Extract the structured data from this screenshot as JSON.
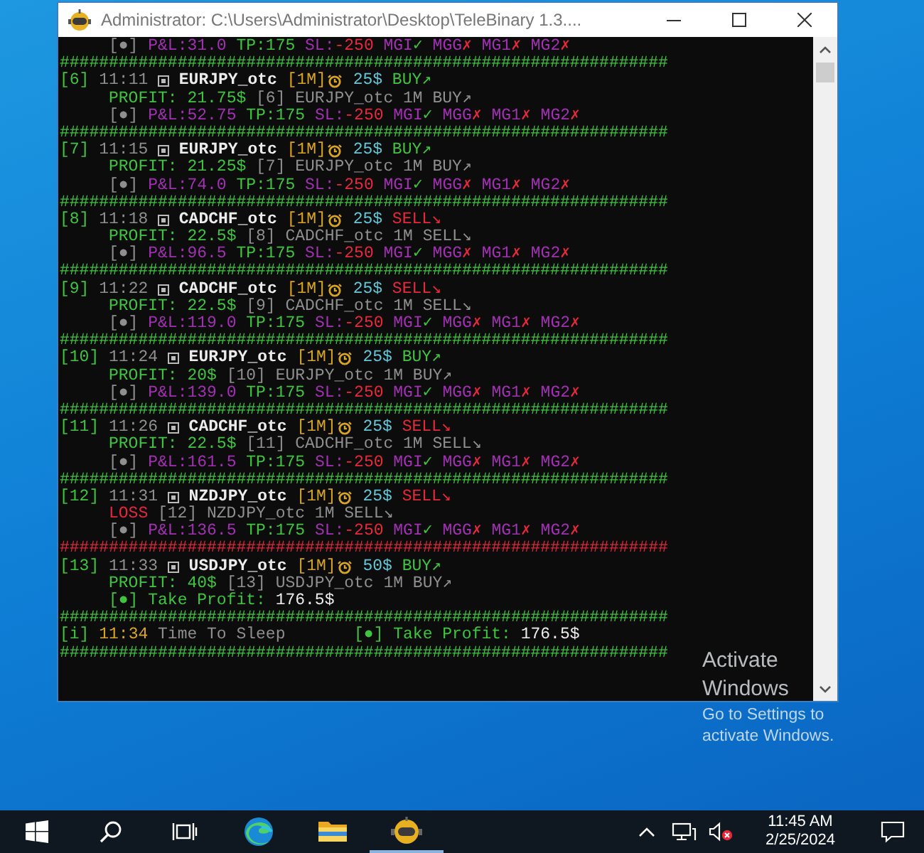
{
  "window": {
    "title": "Administrator: C:\\Users\\Administrator\\Desktop\\TeleBinary 1.3...."
  },
  "console": {
    "lines": [
      {
        "kind": "stats",
        "bullet": "[●]",
        "pnl": "P&L:31.0",
        "tp": "TP:175",
        "sl_label": "SL:",
        "sl_value": "-250",
        "flags": [
          {
            "name": "MGI",
            "mark": "✓",
            "ok": true
          },
          {
            "name": "MGG",
            "mark": "✗",
            "ok": false
          },
          {
            "name": "MG1",
            "mark": "✗",
            "ok": false
          },
          {
            "name": "MG2",
            "mark": "✗",
            "ok": false
          }
        ]
      },
      {
        "kind": "rule",
        "text": "##############################################################",
        "color": "#3ec43e"
      },
      {
        "kind": "trade",
        "index": "[6]",
        "time": "11:11",
        "pair": "EURJPY_otc",
        "timeframe": "[1M]",
        "amount": "25$",
        "signal": "BUY↗",
        "sell": false
      },
      {
        "kind": "result",
        "loss": false,
        "label": "PROFIT: 21.75$",
        "echo": "[6] EURJPY_otc 1M BUY↗"
      },
      {
        "kind": "stats",
        "bullet": "[●]",
        "pnl": "P&L:52.75",
        "tp": "TP:175",
        "sl_label": "SL:",
        "sl_value": "-250",
        "flags": [
          {
            "name": "MGI",
            "mark": "✓",
            "ok": true
          },
          {
            "name": "MGG",
            "mark": "✗",
            "ok": false
          },
          {
            "name": "MG1",
            "mark": "✗",
            "ok": false
          },
          {
            "name": "MG2",
            "mark": "✗",
            "ok": false
          }
        ]
      },
      {
        "kind": "rule",
        "text": "##############################################################",
        "color": "#3ec43e"
      },
      {
        "kind": "trade",
        "index": "[7]",
        "time": "11:15",
        "pair": "EURJPY_otc",
        "timeframe": "[1M]",
        "amount": "25$",
        "signal": "BUY↗",
        "sell": false
      },
      {
        "kind": "result",
        "loss": false,
        "label": "PROFIT: 21.25$",
        "echo": "[7] EURJPY_otc 1M BUY↗"
      },
      {
        "kind": "stats",
        "bullet": "[●]",
        "pnl": "P&L:74.0",
        "tp": "TP:175",
        "sl_label": "SL:",
        "sl_value": "-250",
        "flags": [
          {
            "name": "MGI",
            "mark": "✓",
            "ok": true
          },
          {
            "name": "MGG",
            "mark": "✗",
            "ok": false
          },
          {
            "name": "MG1",
            "mark": "✗",
            "ok": false
          },
          {
            "name": "MG2",
            "mark": "✗",
            "ok": false
          }
        ]
      },
      {
        "kind": "rule",
        "text": "##############################################################",
        "color": "#3ec43e"
      },
      {
        "kind": "trade",
        "index": "[8]",
        "time": "11:18",
        "pair": "CADCHF_otc",
        "timeframe": "[1M]",
        "amount": "25$",
        "signal": "SELL↘",
        "sell": true
      },
      {
        "kind": "result",
        "loss": false,
        "label": "PROFIT: 22.5$",
        "echo": "[8] CADCHF_otc 1M SELL↘"
      },
      {
        "kind": "stats",
        "bullet": "[●]",
        "pnl": "P&L:96.5",
        "tp": "TP:175",
        "sl_label": "SL:",
        "sl_value": "-250",
        "flags": [
          {
            "name": "MGI",
            "mark": "✓",
            "ok": true
          },
          {
            "name": "MGG",
            "mark": "✗",
            "ok": false
          },
          {
            "name": "MG1",
            "mark": "✗",
            "ok": false
          },
          {
            "name": "MG2",
            "mark": "✗",
            "ok": false
          }
        ]
      },
      {
        "kind": "rule",
        "text": "##############################################################",
        "color": "#3ec43e"
      },
      {
        "kind": "trade",
        "index": "[9]",
        "time": "11:22",
        "pair": "CADCHF_otc",
        "timeframe": "[1M]",
        "amount": "25$",
        "signal": "SELL↘",
        "sell": true
      },
      {
        "kind": "result",
        "loss": false,
        "label": "PROFIT: 22.5$",
        "echo": "[9] CADCHF_otc 1M SELL↘"
      },
      {
        "kind": "stats",
        "bullet": "[●]",
        "pnl": "P&L:119.0",
        "tp": "TP:175",
        "sl_label": "SL:",
        "sl_value": "-250",
        "flags": [
          {
            "name": "MGI",
            "mark": "✓",
            "ok": true
          },
          {
            "name": "MGG",
            "mark": "✗",
            "ok": false
          },
          {
            "name": "MG1",
            "mark": "✗",
            "ok": false
          },
          {
            "name": "MG2",
            "mark": "✗",
            "ok": false
          }
        ]
      },
      {
        "kind": "rule",
        "text": "##############################################################",
        "color": "#3ec43e"
      },
      {
        "kind": "trade",
        "index": "[10]",
        "time": "11:24",
        "pair": "EURJPY_otc",
        "timeframe": "[1M]",
        "amount": "25$",
        "signal": "BUY↗",
        "sell": false
      },
      {
        "kind": "result",
        "loss": false,
        "label": "PROFIT: 20$",
        "echo": "[10] EURJPY_otc 1M BUY↗"
      },
      {
        "kind": "stats",
        "bullet": "[●]",
        "pnl": "P&L:139.0",
        "tp": "TP:175",
        "sl_label": "SL:",
        "sl_value": "-250",
        "flags": [
          {
            "name": "MGI",
            "mark": "✓",
            "ok": true
          },
          {
            "name": "MGG",
            "mark": "✗",
            "ok": false
          },
          {
            "name": "MG1",
            "mark": "✗",
            "ok": false
          },
          {
            "name": "MG2",
            "mark": "✗",
            "ok": false
          }
        ]
      },
      {
        "kind": "rule",
        "text": "##############################################################",
        "color": "#3ec43e"
      },
      {
        "kind": "trade",
        "index": "[11]",
        "time": "11:26",
        "pair": "CADCHF_otc",
        "timeframe": "[1M]",
        "amount": "25$",
        "signal": "SELL↘",
        "sell": true
      },
      {
        "kind": "result",
        "loss": false,
        "label": "PROFIT: 22.5$",
        "echo": "[11] CADCHF_otc 1M SELL↘"
      },
      {
        "kind": "stats",
        "bullet": "[●]",
        "pnl": "P&L:161.5",
        "tp": "TP:175",
        "sl_label": "SL:",
        "sl_value": "-250",
        "flags": [
          {
            "name": "MGI",
            "mark": "✓",
            "ok": true
          },
          {
            "name": "MGG",
            "mark": "✗",
            "ok": false
          },
          {
            "name": "MG1",
            "mark": "✗",
            "ok": false
          },
          {
            "name": "MG2",
            "mark": "✗",
            "ok": false
          }
        ]
      },
      {
        "kind": "rule",
        "text": "##############################################################",
        "color": "#3ec43e"
      },
      {
        "kind": "trade",
        "index": "[12]",
        "time": "11:31",
        "pair": "NZDJPY_otc",
        "timeframe": "[1M]",
        "amount": "25$",
        "signal": "SELL↘",
        "sell": true
      },
      {
        "kind": "result",
        "loss": true,
        "label": "LOSS",
        "echo": "[12] NZDJPY_otc 1M SELL↘"
      },
      {
        "kind": "stats",
        "bullet": "[●]",
        "pnl": "P&L:136.5",
        "tp": "TP:175",
        "sl_label": "SL:",
        "sl_value": "-250",
        "flags": [
          {
            "name": "MGI",
            "mark": "✓",
            "ok": true
          },
          {
            "name": "MGG",
            "mark": "✗",
            "ok": false
          },
          {
            "name": "MG1",
            "mark": "✗",
            "ok": false
          },
          {
            "name": "MG2",
            "mark": "✗",
            "ok": false
          }
        ]
      },
      {
        "kind": "rule",
        "text": "##############################################################",
        "color": "#e0283a"
      },
      {
        "kind": "trade",
        "index": "[13]",
        "time": "11:33",
        "pair": "USDJPY_otc",
        "timeframe": "[1M]",
        "amount": "50$",
        "signal": "BUY↗",
        "sell": false
      },
      {
        "kind": "result",
        "loss": false,
        "label": "PROFIT: 40$",
        "echo": "[13] USDJPY_otc 1M BUY↗"
      },
      {
        "kind": "take_profit",
        "bullet": "[●]",
        "label": "Take Profit:",
        "value": "176.5$"
      },
      {
        "kind": "rule",
        "text": "##############################################################",
        "color": "#3ec43e"
      },
      {
        "kind": "sleep",
        "index": "[i]",
        "time": "11:34",
        "text": "Time To Sleep",
        "bullet": "[●]",
        "label": "Take Profit:",
        "value": "176.5$"
      },
      {
        "kind": "rule",
        "text": "##############################################################",
        "color": "#3ec43e"
      }
    ]
  },
  "activation": {
    "title": "Activate Windows",
    "subtitle": "Go to Settings to activate Windows."
  },
  "taskbar": {
    "time": "11:45 AM",
    "date": "2/25/2024"
  }
}
